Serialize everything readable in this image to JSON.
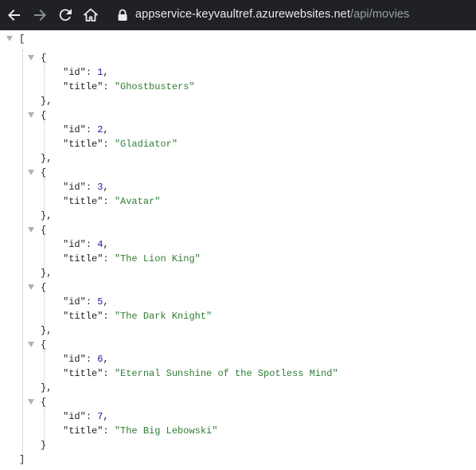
{
  "browser": {
    "url_host": "appservice-keyvaultref.azurewebsites.net",
    "url_path": "/api/movies",
    "icons": {
      "back": "arrow-left-icon",
      "forward": "arrow-right-icon",
      "reload": "reload-icon",
      "home": "home-icon",
      "secure": "lock-icon"
    }
  },
  "json": {
    "open_bracket": "[",
    "close_bracket": "]",
    "open_brace": "{",
    "close_brace_comma": "},",
    "close_brace": "}",
    "id_key": "\"id\"",
    "title_key": "\"title\"",
    "colon": ": ",
    "comma": ",",
    "movies": [
      {
        "id": "1",
        "title": "\"Ghostbusters\""
      },
      {
        "id": "2",
        "title": "\"Gladiator\""
      },
      {
        "id": "3",
        "title": "\"Avatar\""
      },
      {
        "id": "4",
        "title": "\"The Lion King\""
      },
      {
        "id": "5",
        "title": "\"The Dark Knight\""
      },
      {
        "id": "6",
        "title": "\"Eternal Sunshine of the Spotless Mind\""
      },
      {
        "id": "7",
        "title": "\"The Big Lebowski\""
      }
    ]
  }
}
